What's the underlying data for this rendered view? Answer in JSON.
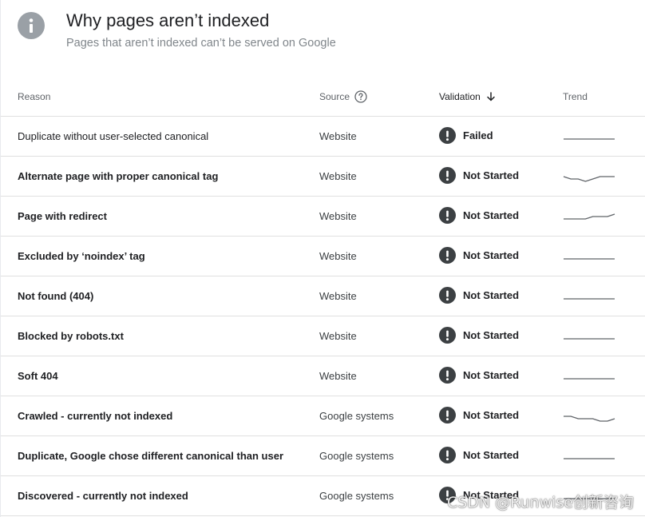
{
  "header": {
    "title": "Why pages aren’t indexed",
    "subtitle": "Pages that aren’t indexed can’t be served on Google",
    "icon": "info-icon"
  },
  "table": {
    "columns": {
      "reason": "Reason",
      "source": "Source",
      "validation": "Validation",
      "trend": "Trend"
    },
    "rows": [
      {
        "reason": "Duplicate without user-selected canonical",
        "source": "Website",
        "validation": "Failed",
        "trend": [
          3,
          3,
          3,
          3,
          3,
          3,
          3,
          3
        ]
      },
      {
        "reason": "Alternate page with proper canonical tag",
        "source": "Website",
        "validation": "Not Started",
        "trend": [
          2,
          3,
          3,
          4,
          3,
          2,
          2,
          2
        ]
      },
      {
        "reason": "Page with redirect",
        "source": "Website",
        "validation": "Not Started",
        "trend": [
          3,
          3,
          3,
          3,
          2,
          2,
          2,
          1
        ]
      },
      {
        "reason": "Excluded by ‘noindex’ tag",
        "source": "Website",
        "validation": "Not Started",
        "trend": [
          3,
          3,
          3,
          3,
          3,
          3,
          3,
          3
        ]
      },
      {
        "reason": "Not found (404)",
        "source": "Website",
        "validation": "Not Started",
        "trend": [
          3,
          3,
          3,
          3,
          3,
          3,
          3,
          3
        ]
      },
      {
        "reason": "Blocked by robots.txt",
        "source": "Website",
        "validation": "Not Started",
        "trend": [
          3,
          3,
          3,
          3,
          3,
          3,
          3,
          3
        ]
      },
      {
        "reason": "Soft 404",
        "source": "Website",
        "validation": "Not Started",
        "trend": [
          3,
          3,
          3,
          3,
          3,
          3,
          3,
          3
        ]
      },
      {
        "reason": "Crawled - currently not indexed",
        "source": "Google systems",
        "validation": "Not Started",
        "trend": [
          2,
          2,
          3,
          3,
          3,
          4,
          4,
          3
        ]
      },
      {
        "reason": "Duplicate, Google chose different canonical than user",
        "source": "Google systems",
        "validation": "Not Started",
        "trend": [
          3,
          3,
          3,
          3,
          3,
          3,
          3,
          3
        ]
      },
      {
        "reason": "Discovered - currently not indexed",
        "source": "Google systems",
        "validation": "Not Started",
        "trend": [
          3,
          3,
          3,
          3,
          3,
          3,
          3,
          3
        ]
      }
    ]
  },
  "watermark": "CSDN @Runwise创新咨询",
  "colors": {
    "status_icon_bg": "#3c4043",
    "info_icon_bg": "#9aa0a6",
    "trend_line": "#5f6368",
    "divider": "#e0e0e0"
  }
}
